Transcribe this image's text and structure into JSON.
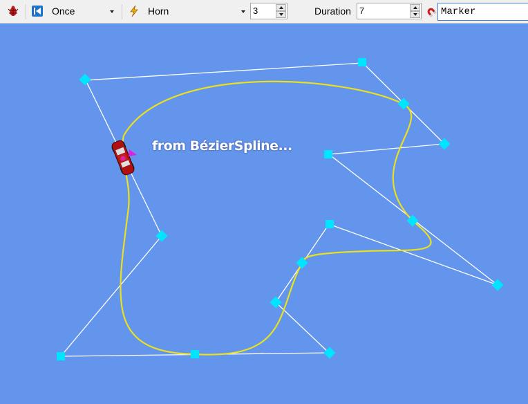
{
  "toolbar": {
    "loop_mode": "Once",
    "sound": "Horn",
    "count_value": "3",
    "duration_label": "Duration",
    "duration_value": "7",
    "marker_value": "Marker"
  },
  "icons": {
    "bug": "bug-icon",
    "loop": "loop-icon",
    "lightning": "lightning-icon",
    "magnet": "magnet-icon",
    "car": "car-icon"
  },
  "canvas": {
    "background": "#6495ed",
    "overlay_text": "from BézierSpline...",
    "curve_color": "#e8e020",
    "control_line_color": "#ffffff",
    "point_color": "#00e5ff",
    "car_color": "#b01010"
  }
}
